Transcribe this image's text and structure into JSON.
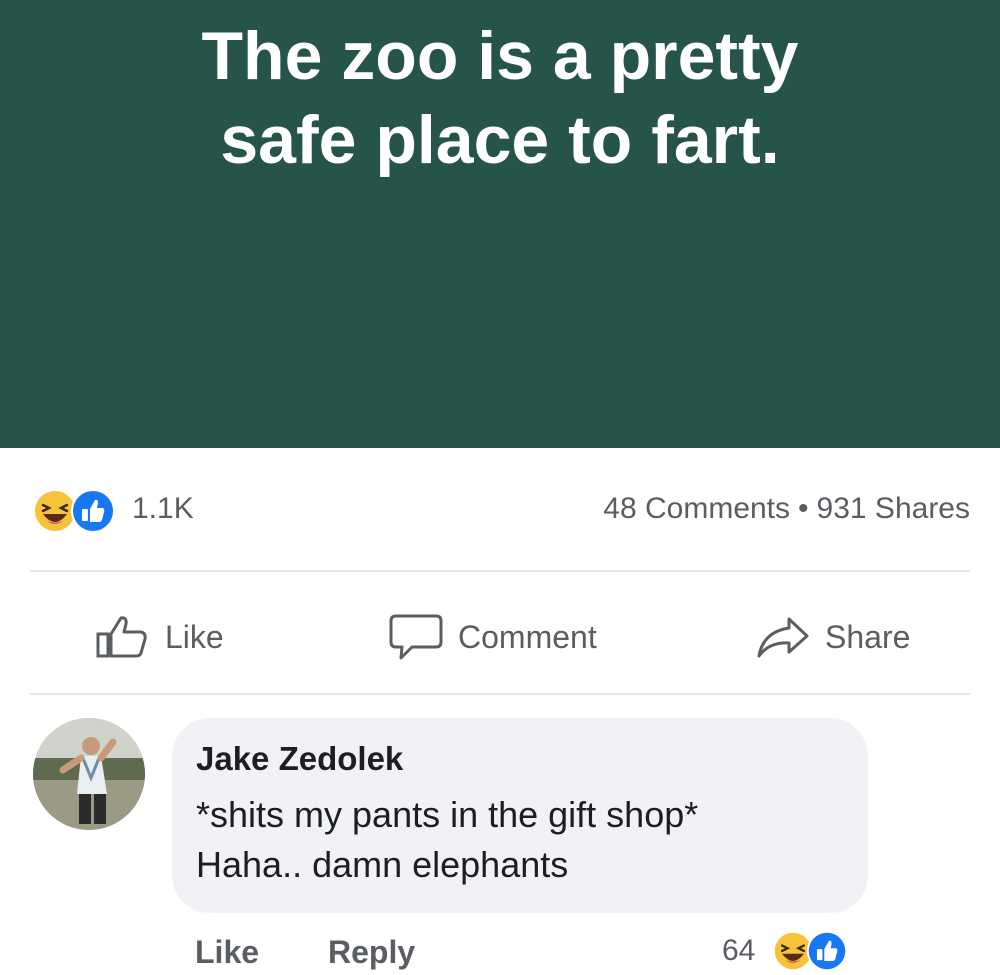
{
  "post": {
    "text_line1": "The zoo is a pretty",
    "text_line2": "safe place to fart.",
    "background_color": "#26544a"
  },
  "stats": {
    "reaction_icons": [
      "haha-icon",
      "like-icon"
    ],
    "reaction_count": "1.1K",
    "comments": "48 Comments",
    "separator": "•",
    "shares": "931 Shares"
  },
  "actions": {
    "like_label": "Like",
    "comment_label": "Comment",
    "share_label": "Share"
  },
  "comment": {
    "author": "Jake Zedolek",
    "line1": "*shits my pants in the gift shop*",
    "line2": "Haha.. damn elephants",
    "like_label": "Like",
    "reply_label": "Reply",
    "reaction_count": "64",
    "reaction_icons": [
      "haha-icon",
      "like-icon"
    ]
  },
  "colors": {
    "like_blue": "#1877f2",
    "haha_yellow": "#f7c33b",
    "muted_text": "#5a5d62"
  }
}
